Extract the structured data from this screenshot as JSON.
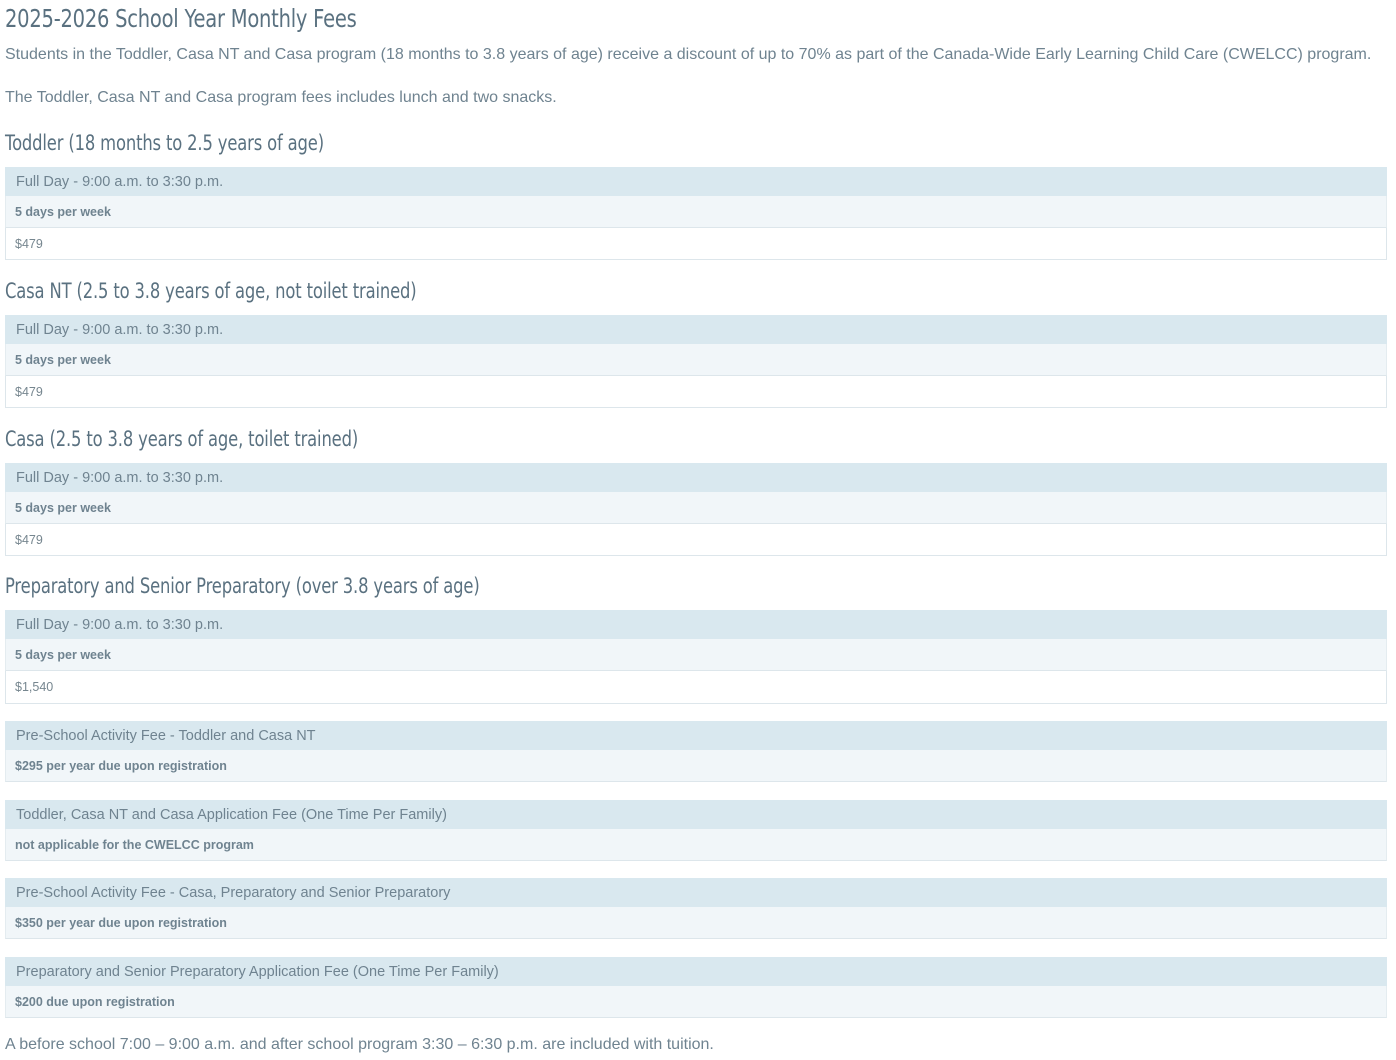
{
  "title": "2025-2026 School Year Monthly Fees",
  "intro": {
    "discount": "Students in the Toddler, Casa NT and Casa program (18 months to 3.8 years of age) receive a discount of up to 70% as part of the Canada-Wide Early Learning Child Care (CWELCC) program.",
    "includes": "The Toddler, Casa NT and Casa program fees includes lunch and two snacks."
  },
  "programs": [
    {
      "heading": "Toddler (18 months to 2.5 years of age)",
      "schedule": "Full Day - 9:00 a.m. to 3:30 p.m.",
      "frequency": "5 days per week",
      "price": "$479"
    },
    {
      "heading": "Casa NT (2.5 to 3.8 years of age, not toilet trained)",
      "schedule": "Full Day - 9:00 a.m. to 3:30 p.m.",
      "frequency": "5 days per week",
      "price": "$479"
    },
    {
      "heading": "Casa (2.5 to 3.8 years of age, toilet trained)",
      "schedule": "Full Day - 9:00 a.m. to 3:30 p.m.",
      "frequency": "5 days per week",
      "price": "$479"
    },
    {
      "heading": "Preparatory and Senior Preparatory (over 3.8 years of age)",
      "schedule": "Full Day - 9:00 a.m. to 3:30 p.m.",
      "frequency": "5 days per week",
      "price": "$1,540"
    }
  ],
  "fees": [
    {
      "label": "Pre-School Activity Fee - Toddler and Casa NT",
      "detail": "$295 per year due upon registration"
    },
    {
      "label": "Toddler, Casa NT and Casa Application Fee (One Time Per Family)",
      "detail": "not applicable for the CWELCC program"
    },
    {
      "label": "Pre-School Activity Fee - Casa, Preparatory and Senior Preparatory",
      "detail": "$350 per year due upon registration"
    },
    {
      "label": "Preparatory and Senior Preparatory Application Fee (One Time Per Family)",
      "detail": "$200 due upon registration"
    }
  ],
  "footer": "A before school 7:00 – 9:00 a.m. and after school program 3:30 – 6:30 p.m. are included with tuition."
}
